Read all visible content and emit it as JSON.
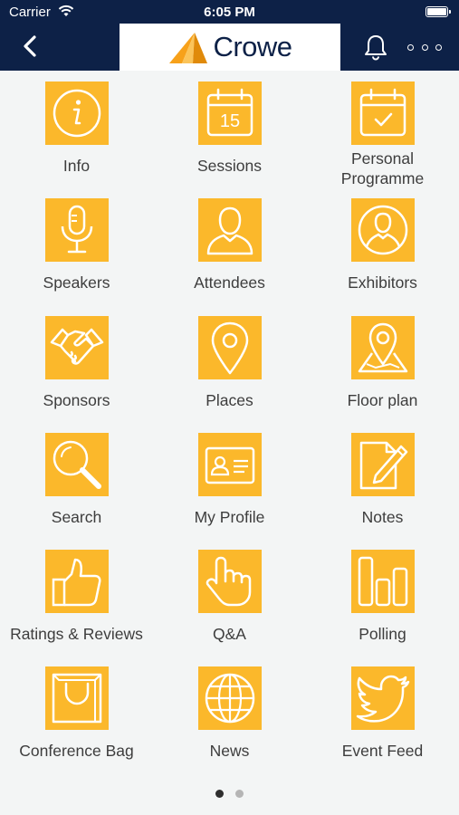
{
  "status_bar": {
    "carrier": "Carrier",
    "time": "6:05 PM"
  },
  "header": {
    "logo_text": "Crowe",
    "back_icon": "chevron-left-icon",
    "notifications_icon": "bell-icon",
    "more_icon": "ellipsis-icon"
  },
  "tiles": [
    {
      "label": "Info",
      "icon": "info-icon"
    },
    {
      "label": "Sessions",
      "icon": "calendar-icon",
      "badge": "15"
    },
    {
      "label": "Personal\nProgramme",
      "icon": "calendar-check-icon"
    },
    {
      "label": "Speakers",
      "icon": "microphone-icon"
    },
    {
      "label": "Attendees",
      "icon": "person-icon"
    },
    {
      "label": "Exhibitors",
      "icon": "person-circle-icon"
    },
    {
      "label": "Sponsors",
      "icon": "handshake-icon"
    },
    {
      "label": "Places",
      "icon": "map-pin-icon"
    },
    {
      "label": "Floor plan",
      "icon": "map-icon"
    },
    {
      "label": "Search",
      "icon": "search-icon"
    },
    {
      "label": "My Profile",
      "icon": "id-card-icon"
    },
    {
      "label": "Notes",
      "icon": "note-pencil-icon"
    },
    {
      "label": "Ratings & Reviews",
      "icon": "thumbs-up-icon"
    },
    {
      "label": "Q&A",
      "icon": "pointing-hand-icon"
    },
    {
      "label": "Polling",
      "icon": "bar-chart-icon"
    },
    {
      "label": "Conference Bag",
      "icon": "shopping-bag-icon"
    },
    {
      "label": "News",
      "icon": "globe-icon"
    },
    {
      "label": "Event Feed",
      "icon": "bird-icon"
    }
  ],
  "pagination": {
    "pages": 2,
    "current": 1
  },
  "colors": {
    "header": "#0d2147",
    "tile": "#fbb82b",
    "background": "#f3f5f5",
    "logo_orange": "#f7a11a"
  }
}
